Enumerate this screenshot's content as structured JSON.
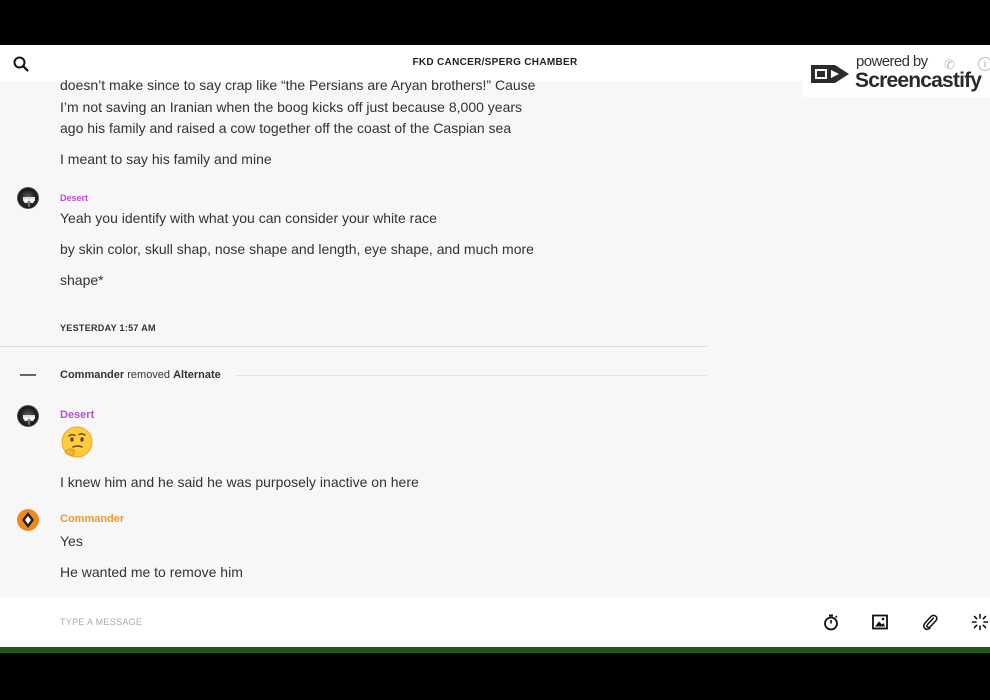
{
  "header": {
    "title": "FKD CANCER/SPERG CHAMBER"
  },
  "watermark": {
    "powered_by": "powered by",
    "brand": "Screencastify"
  },
  "messages": {
    "m1_line1": "doesn’t make since to say crap like “the Persians are Aryan brothers!” Cause",
    "m1_line2": "I’m not saving an Iranian when the boog kicks off just because 8,000 years",
    "m1_line3": "ago his family and raised a cow together off the coast of the Caspian sea",
    "m2": "I meant to say his family and mine",
    "g2_sender": "Desert",
    "m3": "Yeah you identify with what you can consider your white race",
    "m4": "by skin color, skull shap, nose shape and length, eye shape, and much more",
    "m5": "shape*",
    "date_separator": "YESTERDAY 1:57 AM",
    "system": {
      "actor": "Commander",
      "action": "removed",
      "target": "Alternate"
    },
    "g3_sender": "Desert",
    "g3_emoji": "thinking-face",
    "m6": "I knew him and he said he was purposely inactive on here",
    "g4_sender": "Commander",
    "m7": "Yes",
    "m8": "He wanted me to remove him"
  },
  "composer": {
    "placeholder": "TYPE A MESSAGE"
  },
  "icons": {
    "search": "search-icon",
    "timer": "stopwatch-icon",
    "image": "image-icon",
    "attach": "paperclip-icon",
    "more": "sparkle-icon"
  },
  "colors": {
    "desert": "#b94fd1",
    "commander": "#ec9a2e",
    "background": "#f7f7f7"
  }
}
